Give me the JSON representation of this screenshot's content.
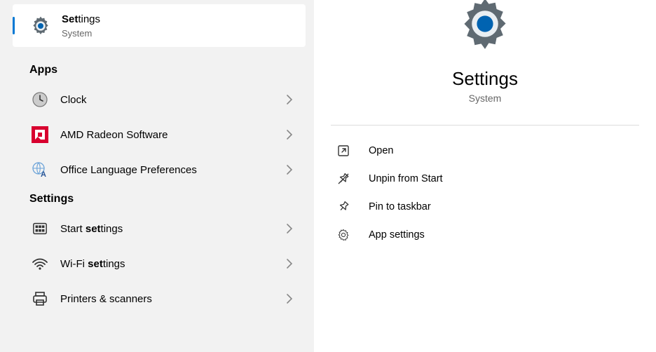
{
  "best_match": {
    "title_bold": "Set",
    "title_rest": "tings",
    "subtitle": "System"
  },
  "sections": {
    "apps_header": "Apps",
    "settings_header": "Settings"
  },
  "apps": [
    {
      "label": "Clock"
    },
    {
      "label": "AMD Radeon Software"
    },
    {
      "label": "Office Language Preferences"
    }
  ],
  "settings_items": [
    {
      "prefix": "Start ",
      "bold": "set",
      "suffix": "tings"
    },
    {
      "prefix": "Wi-Fi ",
      "bold": "set",
      "suffix": "tings"
    },
    {
      "prefix": "Printers & scanners",
      "bold": "",
      "suffix": ""
    }
  ],
  "detail": {
    "title": "Settings",
    "subtitle": "System",
    "actions": [
      {
        "label": "Open"
      },
      {
        "label": "Unpin from Start"
      },
      {
        "label": "Pin to taskbar"
      },
      {
        "label": "App settings"
      }
    ]
  }
}
